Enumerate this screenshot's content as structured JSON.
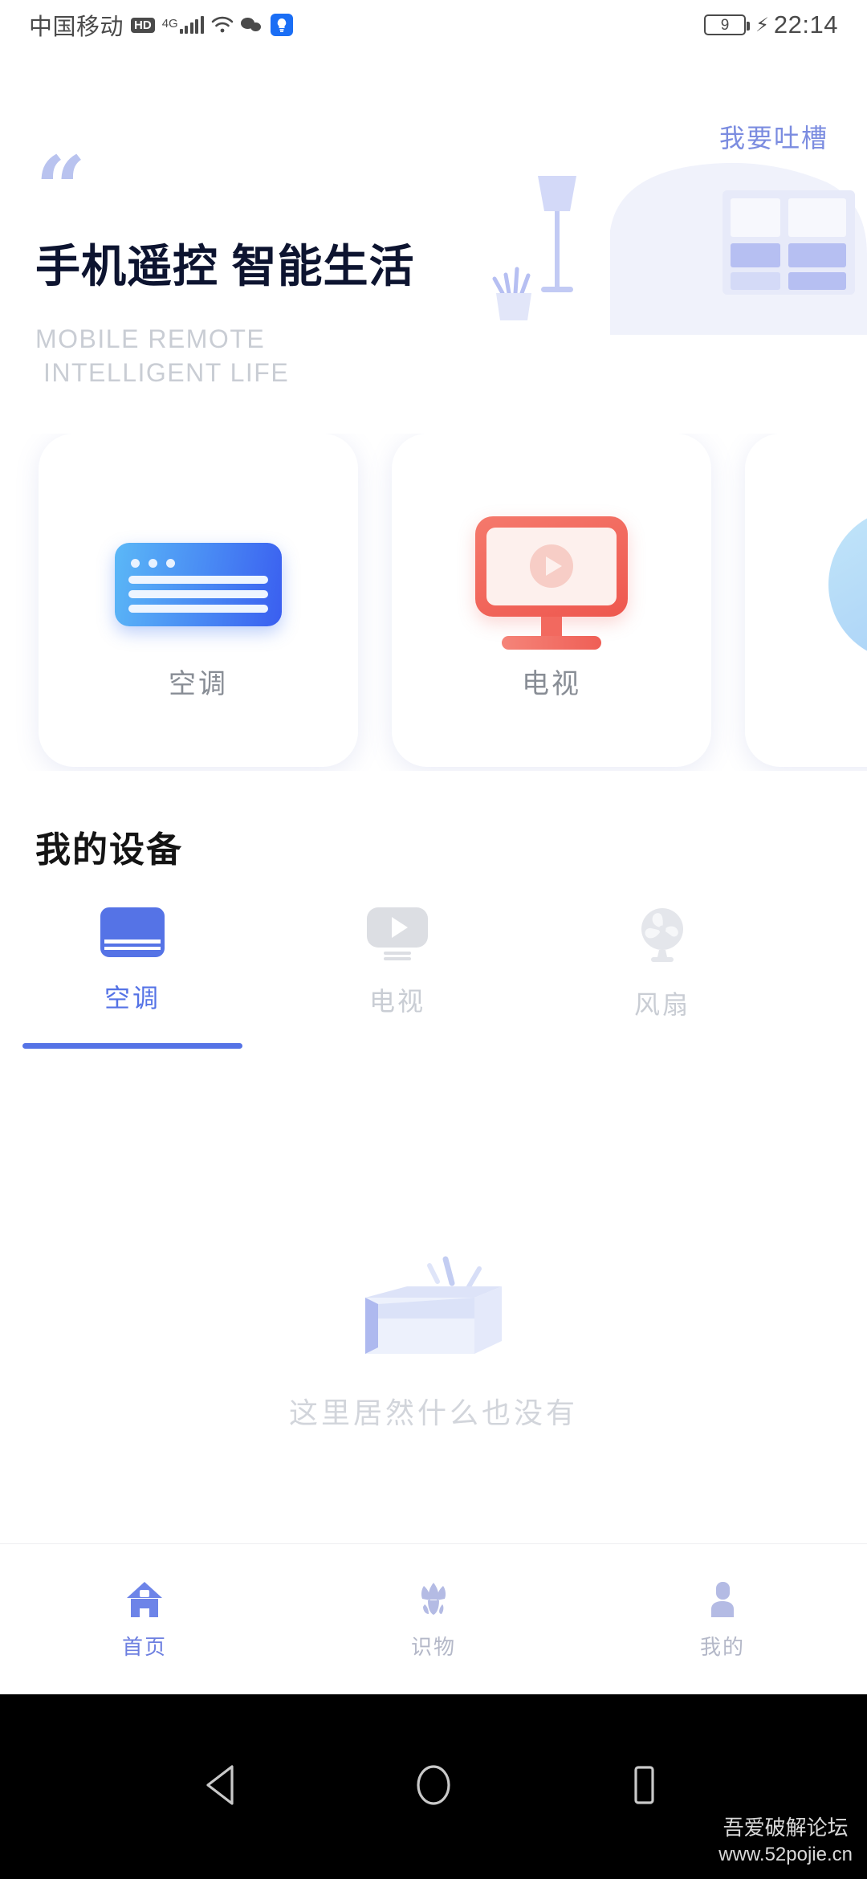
{
  "statusbar": {
    "carrier": "中国移动",
    "hd_badge": "HD",
    "network_type": "4G",
    "battery_level": "9",
    "time": "22:14"
  },
  "hero": {
    "feedback_link": "我要吐槽",
    "quote_mark": "“",
    "title": "手机遥控 智能生活",
    "subtitle_line1": "MOBILE REMOTE",
    "subtitle_line2": "INTELLIGENT LIFE"
  },
  "quick_cards": [
    {
      "label": "空调",
      "icon": "air-conditioner-icon"
    },
    {
      "label": "电视",
      "icon": "television-icon"
    },
    {
      "label": "",
      "icon": "globe-icon"
    }
  ],
  "my_devices": {
    "title": "我的设备",
    "tabs": [
      {
        "label": "空调",
        "icon": "air-conditioner-icon",
        "active": true
      },
      {
        "label": "电视",
        "icon": "television-icon",
        "active": false
      },
      {
        "label": "风扇",
        "icon": "fan-icon",
        "active": false
      }
    ],
    "empty_text": "这里居然什么也没有"
  },
  "bottom_nav": [
    {
      "label": "首页",
      "icon": "home-icon",
      "active": true
    },
    {
      "label": "识物",
      "icon": "flower-recognize-icon",
      "active": false
    },
    {
      "label": "我的",
      "icon": "person-icon",
      "active": false
    }
  ],
  "android_nav": {
    "back": "back-triangle-icon",
    "home": "home-circle-icon",
    "recents": "recents-square-icon"
  },
  "watermark": {
    "line1": "吾爱破解论坛",
    "line2": "www.52pojie.cn"
  },
  "colors": {
    "accent_blue": "#5573e6",
    "title_navy": "#0d1430",
    "muted_gray": "#c9cdd4",
    "tv_red": "#ef5a53"
  }
}
